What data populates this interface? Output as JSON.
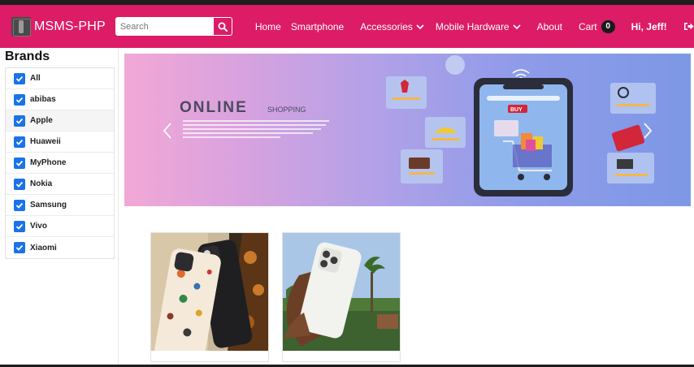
{
  "navbar": {
    "brand": "MSMS-PHP",
    "search_placeholder": "Search",
    "links": {
      "home": "Home",
      "smartphone": "Smartphone",
      "accessories": "Accessories",
      "mobile_hardware": "Mobile Hardware",
      "about": "About",
      "cart": "Cart"
    },
    "cart_count": "0",
    "user_greeting": "Hi, Jeff!",
    "accent_color": "#dc1c66"
  },
  "sidebar": {
    "title": "Brands",
    "brands": [
      {
        "label": "All",
        "checked": true
      },
      {
        "label": "abibas",
        "checked": true
      },
      {
        "label": "Apple",
        "checked": true
      },
      {
        "label": "Huaweii",
        "checked": true
      },
      {
        "label": "MyPhone",
        "checked": true
      },
      {
        "label": "Nokia",
        "checked": true
      },
      {
        "label": "Samsung",
        "checked": true
      },
      {
        "label": "Vivo",
        "checked": true
      },
      {
        "label": "Xiaomi",
        "checked": true
      }
    ]
  },
  "banner": {
    "headline": "ONLINE",
    "subheadline": "SHOPPING",
    "phone_button": "BUY"
  },
  "icons": [
    "search-icon",
    "chevron-down-icon",
    "logout-icon",
    "checkmark-icon",
    "carousel-prev-icon",
    "carousel-next-icon"
  ]
}
